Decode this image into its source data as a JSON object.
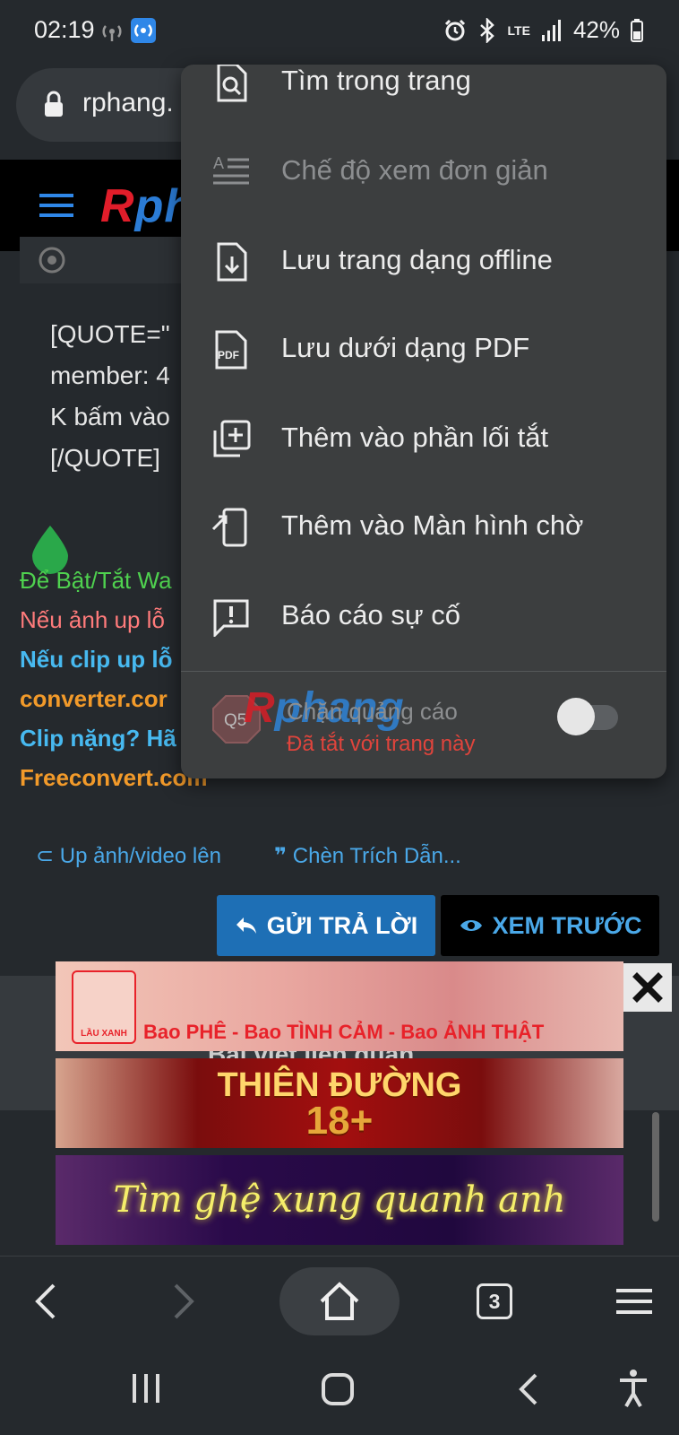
{
  "status_bar": {
    "time": "02:19",
    "network": "LTE",
    "battery": "42%",
    "icons": [
      "hotspot-icon",
      "wifi-calling-icon",
      "alarm-icon",
      "bluetooth-icon",
      "signal-icon",
      "battery-icon"
    ]
  },
  "address_bar": {
    "url": "rphang."
  },
  "site": {
    "logo": {
      "r": "R",
      "rest": "ph"
    }
  },
  "post": {
    "quote_lines": "[QUOTE=\"\nmember: 4\nK bấm vào\n[/QUOTE]",
    "line1": "Để Bật/Tắt Wa",
    "line2": "Nếu ảnh up lỗ",
    "line3": "Nếu clip up lỗ",
    "line4": "converter.cor",
    "line5": "Clip nặng? Hã",
    "line6": "Freeconvert.com",
    "upload_link": "Up ảnh/video lên",
    "quote_link": "Chèn Trích Dẫn...",
    "reply_button": "GỬI TRẢ LỜI",
    "preview_button": "XEM TRƯỚC"
  },
  "related": {
    "title": "Bài viết liên quan"
  },
  "ads": {
    "banner1_text": "Bao PHÊ - Bao TÌNH CẢM - Bao ẢNH THẬT",
    "banner1_logo": "LẦU XANH",
    "banner2_line1": "THIÊN ĐƯỜNG",
    "banner2_line2": "18+",
    "banner3_text": "Tìm ghệ xung quanh anh"
  },
  "menu": {
    "items": [
      {
        "label": "Tìm trong trang",
        "icon": "find-in-page-icon",
        "disabled": false
      },
      {
        "label": "Chế độ xem đơn giản",
        "icon": "simple-view-icon",
        "disabled": true
      },
      {
        "label": "Lưu trang dạng offline",
        "icon": "save-offline-icon",
        "disabled": false
      },
      {
        "label": "Lưu dưới dạng PDF",
        "icon": "pdf-icon",
        "disabled": false
      },
      {
        "label": "Thêm vào phần lối tắt",
        "icon": "add-shortcut-icon",
        "disabled": false
      },
      {
        "label": "Thêm vào Màn hình chờ",
        "icon": "add-home-screen-icon",
        "disabled": false
      },
      {
        "label": "Báo cáo sự cố",
        "icon": "report-issue-icon",
        "disabled": false
      }
    ],
    "adblock": {
      "title": "Chặn quảng cáo",
      "subtitle": "Đã tắt với trang này",
      "badge": "Q5",
      "enabled": false
    },
    "watermark": {
      "r": "R",
      "rest": "phang"
    }
  },
  "bottom_toolbar": {
    "tab_count": "3"
  }
}
